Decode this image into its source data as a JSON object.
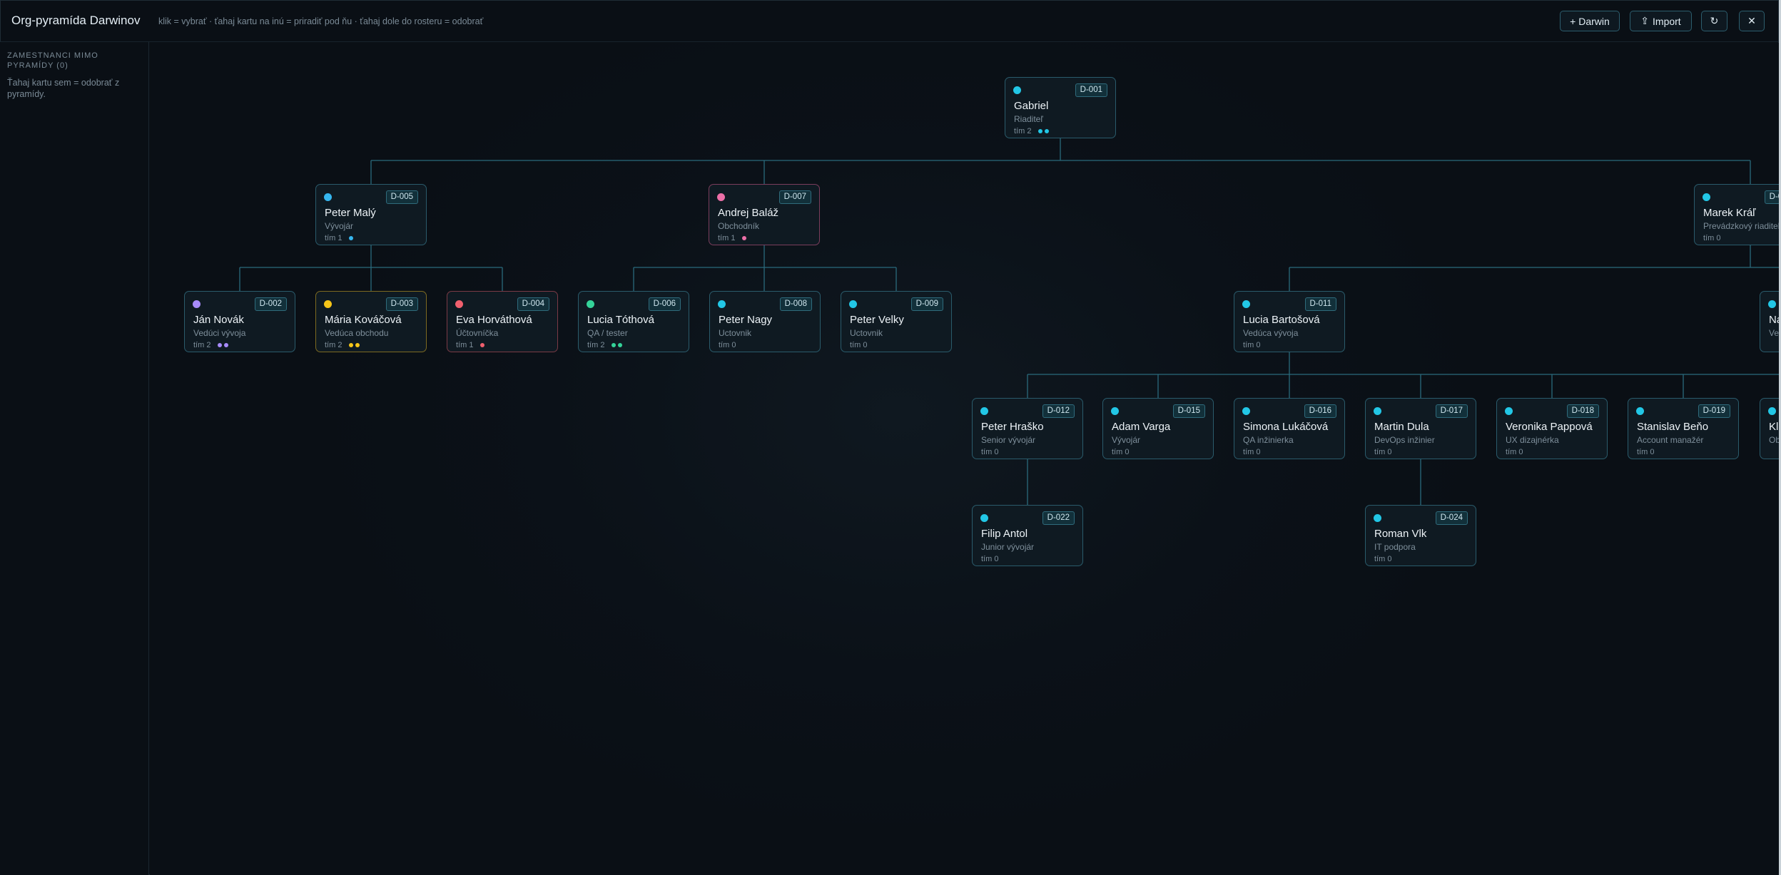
{
  "header": {
    "title": "Org-pyramída Darwinov",
    "hint": "klik = vybrať · ťahaj kartu na inú = priradiť pod ňu · ťahaj dole do rosteru = odobrať",
    "add_label": "+ Darwin",
    "import_label": "Import"
  },
  "sidebar": {
    "heading": "ZAMESTNANCI MIMO PYRAMÍDY (0)",
    "text": "Ťahaj kartu sem = odobrať z pyramídy."
  },
  "colors": {
    "accent": "#2a6a7c",
    "line": "#2a6a7c"
  },
  "nodes": [
    {
      "id": "D-001",
      "name": "Gabriel",
      "role": "Riaditeľ",
      "team": "tím 2",
      "dot": "#22c7e6",
      "subs": [
        "#22c7e6",
        "#22c7e6"
      ]
    },
    {
      "id": "D-005",
      "name": "Peter Malý",
      "role": "Vývojár",
      "team": "tím 1",
      "dot": "#36b6ef",
      "subs": [
        "#36b6ef"
      ]
    },
    {
      "id": "D-007",
      "name": "Andrej Baláž",
      "role": "Obchodník",
      "team": "tím 1",
      "dot": "#ec6fa7",
      "subs": [
        "#ec6fa7"
      ],
      "border": "#7a3d5c"
    },
    {
      "id": "D-010",
      "name": "Marek Kráľ",
      "role": "Prevádzkový riaditeľ",
      "team": "tím 0",
      "dot": "#22c7e6",
      "subs": []
    },
    {
      "id": "D-002",
      "name": "Ján Novák",
      "role": "Vedúci vývoja",
      "team": "tím 2",
      "dot": "#a78bfa",
      "subs": [
        "#a78bfa",
        "#a78bfa"
      ]
    },
    {
      "id": "D-003",
      "name": "Mária Kováčová",
      "role": "Vedúca obchodu",
      "team": "tím 2",
      "dot": "#f5c518",
      "subs": [
        "#f5c518",
        "#f5c518"
      ],
      "border": "#7d6a21"
    },
    {
      "id": "D-004",
      "name": "Eva Horváthová",
      "role": "Účtovníčka",
      "team": "tím 1",
      "dot": "#f0606e",
      "subs": [
        "#f0606e"
      ],
      "border": "#7a3a45"
    },
    {
      "id": "D-006",
      "name": "Lucia Tóthová",
      "role": "QA / tester",
      "team": "tím 2",
      "dot": "#34d399",
      "subs": [
        "#34d399",
        "#34d399"
      ]
    },
    {
      "id": "D-008",
      "name": "Peter Nagy",
      "role": "Uctovnik",
      "team": "tím 0",
      "dot": "#22c7e6",
      "subs": []
    },
    {
      "id": "D-009",
      "name": "Peter Velky",
      "role": "Uctovnik",
      "team": "tím 0",
      "dot": "#22c7e6",
      "subs": []
    },
    {
      "id": "D-011",
      "name": "Lucia Bartošová",
      "role": "Vedúca vývoja",
      "team": "tím 0",
      "dot": "#22c7e6",
      "subs": []
    },
    {
      "id": "D-013",
      "name": "Na",
      "role": "Ve",
      "team": "",
      "dot": "#22c7e6",
      "subs": []
    },
    {
      "id": "D-012",
      "name": "Peter Hraško",
      "role": "Senior vývojár",
      "team": "tím 0",
      "dot": "#22c7e6",
      "subs": []
    },
    {
      "id": "D-015",
      "name": "Adam Varga",
      "role": "Vývojár",
      "team": "tím 0",
      "dot": "#22c7e6",
      "subs": []
    },
    {
      "id": "D-016",
      "name": "Simona Lukáčová",
      "role": "QA inžinierka",
      "team": "tím 0",
      "dot": "#22c7e6",
      "subs": []
    },
    {
      "id": "D-017",
      "name": "Martin Dula",
      "role": "DevOps inžinier",
      "team": "tím 0",
      "dot": "#22c7e6",
      "subs": []
    },
    {
      "id": "D-018",
      "name": "Veronika Pappová",
      "role": "UX dizajnérka",
      "team": "tím 0",
      "dot": "#22c7e6",
      "subs": []
    },
    {
      "id": "D-019",
      "name": "Stanislav Beňo",
      "role": "Account manažér",
      "team": "tím 0",
      "dot": "#22c7e6",
      "subs": []
    },
    {
      "id": "D-020",
      "name": "Kl",
      "role": "Ob",
      "team": "",
      "dot": "#22c7e6",
      "subs": []
    },
    {
      "id": "D-022",
      "name": "Filip Antol",
      "role": "Junior vývojár",
      "team": "tím 0",
      "dot": "#22c7e6",
      "subs": []
    },
    {
      "id": "D-024",
      "name": "Roman Vlk",
      "role": "IT podpora",
      "team": "tím 0",
      "dot": "#22c7e6",
      "subs": []
    }
  ]
}
